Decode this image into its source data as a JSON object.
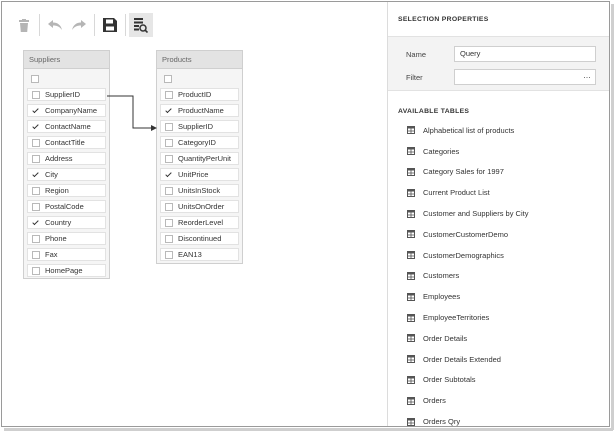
{
  "toolbar": {
    "buttons": [
      {
        "name": "delete-button",
        "icon": "trash-icon"
      },
      {
        "name": "undo-button",
        "icon": "undo-icon"
      },
      {
        "name": "redo-button",
        "icon": "redo-icon"
      },
      {
        "name": "save-button",
        "icon": "save-icon"
      },
      {
        "name": "preview-results-button",
        "icon": "data-preview-icon"
      }
    ]
  },
  "tables": {
    "suppliers": {
      "title": "Suppliers",
      "fields": [
        {
          "label": "SupplierID",
          "checked": false
        },
        {
          "label": "CompanyName",
          "checked": true
        },
        {
          "label": "ContactName",
          "checked": true
        },
        {
          "label": "ContactTitle",
          "checked": false
        },
        {
          "label": "Address",
          "checked": false
        },
        {
          "label": "City",
          "checked": true
        },
        {
          "label": "Region",
          "checked": false
        },
        {
          "label": "PostalCode",
          "checked": false
        },
        {
          "label": "Country",
          "checked": true
        },
        {
          "label": "Phone",
          "checked": false
        },
        {
          "label": "Fax",
          "checked": false
        },
        {
          "label": "HomePage",
          "checked": false
        }
      ]
    },
    "products": {
      "title": "Products",
      "fields": [
        {
          "label": "ProductID",
          "checked": false
        },
        {
          "label": "ProductName",
          "checked": true
        },
        {
          "label": "SupplierID",
          "checked": false
        },
        {
          "label": "CategoryID",
          "checked": false
        },
        {
          "label": "QuantityPerUnit",
          "checked": false
        },
        {
          "label": "UnitPrice",
          "checked": true
        },
        {
          "label": "UnitsInStock",
          "checked": false
        },
        {
          "label": "UnitsOnOrder",
          "checked": false
        },
        {
          "label": "ReorderLevel",
          "checked": false
        },
        {
          "label": "Discontinued",
          "checked": false
        },
        {
          "label": "EAN13",
          "checked": false
        }
      ]
    }
  },
  "panel": {
    "selection_title": "SELECTION PROPERTIES",
    "name_label": "Name",
    "name_value": "Query",
    "filter_label": "Filter",
    "filter_value": "",
    "filter_button": "…",
    "available_title": "AVAILABLE TABLES",
    "available_tables": [
      "Alphabetical list of products",
      "Categories",
      "Category Sales for 1997",
      "Current Product List",
      "Customer and Suppliers by City",
      "CustomerCustomerDemo",
      "CustomerDemographics",
      "Customers",
      "Employees",
      "EmployeeTerritories",
      "Order Details",
      "Order Details Extended",
      "Order Subtotals",
      "Orders",
      "Orders Qry"
    ]
  },
  "colors": {
    "accent_dark": "#333333",
    "icon_gray": "#b5b5b5",
    "header_gray": "#e3e3e3",
    "panel_gray": "#f3f3f3"
  }
}
